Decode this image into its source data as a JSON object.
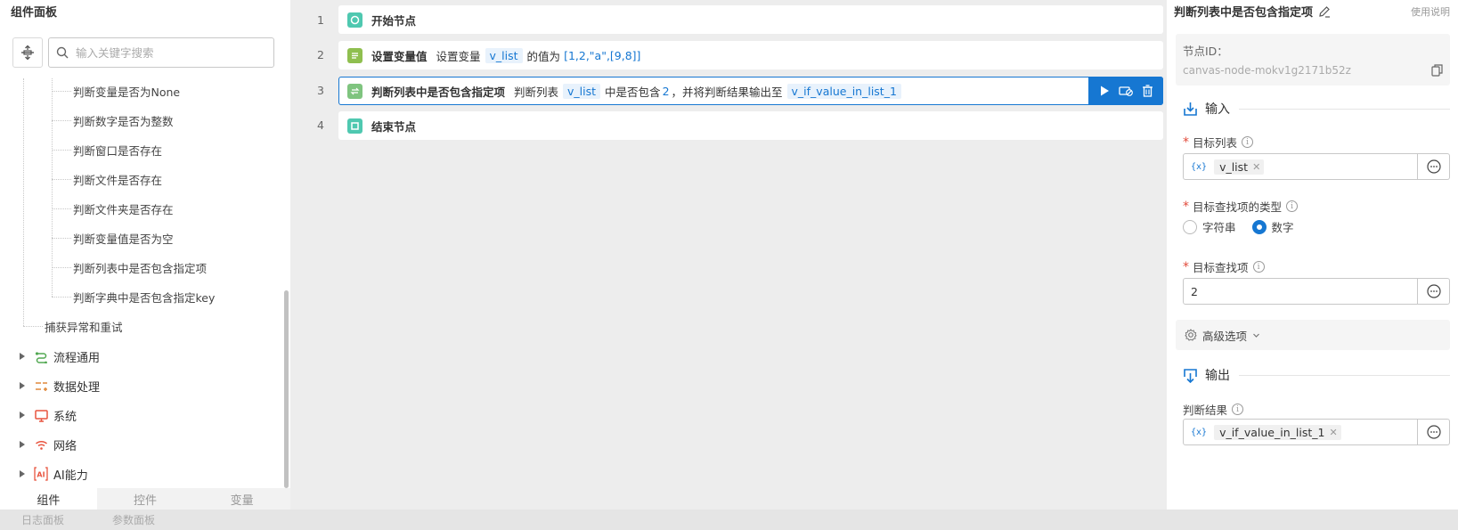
{
  "left_panel": {
    "title": "组件面板",
    "search_placeholder": "输入关键字搜索",
    "tree_children": [
      "判断变量是否为None",
      "判断数字是否为整数",
      "判断窗口是否存在",
      "判断文件是否存在",
      "判断文件夹是否存在",
      "判断变量值是否为空",
      "判断列表中是否包含指定项",
      "判断字典中是否包含指定key"
    ],
    "tree_parent": "捕获异常和重试",
    "categories": [
      {
        "label": "流程通用",
        "icon": "flow-icon",
        "color": "#52a852"
      },
      {
        "label": "数据处理",
        "icon": "data-process-icon",
        "color": "#e0883a"
      },
      {
        "label": "系统",
        "icon": "monitor-icon",
        "color": "#e8543f"
      },
      {
        "label": "网络",
        "icon": "wifi-icon",
        "color": "#e8543f"
      },
      {
        "label": "AI能力",
        "icon": "ai-icon",
        "color": "#e8543f"
      }
    ],
    "tabs": [
      "组件",
      "控件",
      "变量"
    ]
  },
  "bottom_tabs": [
    "日志面板",
    "参数面板"
  ],
  "canvas": {
    "rows": [
      {
        "num": "1",
        "title": "开始节点",
        "icon": "start-icon",
        "icon_color": "#4fc8b0"
      },
      {
        "num": "2",
        "title": "设置变量值",
        "icon": "set-variable-icon",
        "icon_color": "#8fbf4f",
        "parts": {
          "t1": "设置变量",
          "var": "v_list",
          "t2": "的值为",
          "value": "[1,2,\"a\",[9,8]]"
        }
      },
      {
        "num": "3",
        "title": "判断列表中是否包含指定项",
        "icon": "condition-icon",
        "icon_color": "#7fc47f",
        "parts": {
          "t1": "判断列表",
          "var": "v_list",
          "t2": "中是否包含",
          "value": "2",
          "t3": "，并将判断结果输出至",
          "out": "v_if_value_in_list_1"
        }
      },
      {
        "num": "4",
        "title": "结束节点",
        "icon": "end-icon",
        "icon_color": "#4fc8b0"
      }
    ],
    "accent": "#1677d2"
  },
  "right_panel": {
    "title": "判断列表中是否包含指定项",
    "usage": "使用说明",
    "node_id_label": "节点ID：",
    "node_id": "canvas-node-mokv1g2171b52z",
    "input_section": "输入",
    "target_list_label": "目标列表",
    "target_list_value": "v_list",
    "search_type_label": "目标查找项的类型",
    "radio_options": [
      "字符串",
      "数字"
    ],
    "radio_selected": "数字",
    "search_item_label": "目标查找项",
    "search_item_value": "2",
    "advanced": "高级选项",
    "output_section": "输出",
    "result_label": "判断结果",
    "result_value": "v_if_value_in_list_1",
    "fx_glyph": "{x}"
  }
}
